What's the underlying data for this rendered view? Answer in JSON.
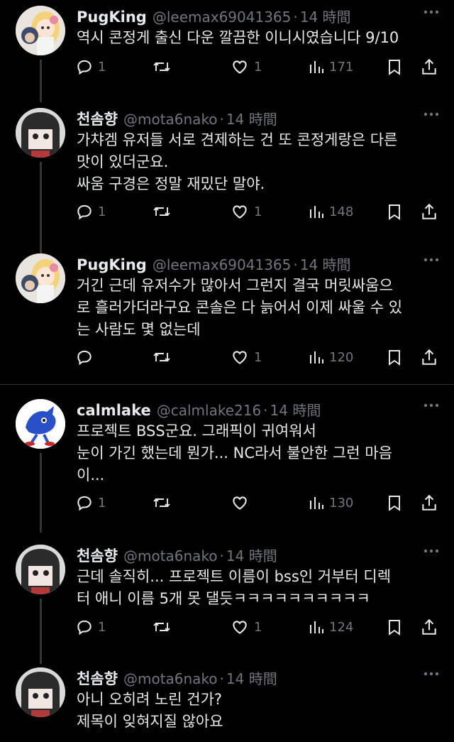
{
  "tweets": [
    {
      "name": "PugKing",
      "handle": "@leemax69041365",
      "dot": "·",
      "time": "14 時間",
      "text": "역시 콘정게 출신 다운 깔끔한 이니시였습니다 9/10",
      "replies": "1",
      "retweets": "",
      "likes": "1",
      "views": "171",
      "avatar": "pugking"
    },
    {
      "name": "천솜향",
      "handle": "@mota6nako",
      "dot": "·",
      "time": "14 時間",
      "text": "가챠겜 유저들 서로 견제하는 건 또 콘정게랑은 다른\n맛이 있더군요.\n싸움 구경은 정말 재밌단 말야.",
      "replies": "1",
      "retweets": "",
      "likes": "1",
      "views": "148",
      "avatar": "mota"
    },
    {
      "name": "PugKing",
      "handle": "@leemax69041365",
      "dot": "·",
      "time": "14 時間",
      "text": "거긴 근데 유저수가 많아서 그런지 결국 머릿싸움으\n로 흘러가더라구요 콘솔은 다 늙어서 이제 싸울 수 있\n는 사람도 몇 없는데",
      "replies": "",
      "retweets": "",
      "likes": "1",
      "views": "120",
      "avatar": "pugking"
    },
    {
      "name": "calmlake",
      "handle": "@calmlake216",
      "dot": "·",
      "time": "14 時間",
      "text": "프로젝트 BSS군요. 그래픽이 귀여워서\n눈이 가긴 했는데 뭔가... NC라서 불안한 그런 마음\n이...",
      "replies": "1",
      "retweets": "",
      "likes": "",
      "views": "130",
      "avatar": "calmlake"
    },
    {
      "name": "천솜향",
      "handle": "@mota6nako",
      "dot": "·",
      "time": "14 時間",
      "text": "근데 솔직히... 프로젝트 이름이 bss인 거부터 디렉\n터 애니 이름 5개 못 댈듯ㅋㅋㅋㅋㅋㅋㅋㅋㅋㅋ",
      "replies": "1",
      "retweets": "",
      "likes": "1",
      "views": "124",
      "avatar": "mota"
    },
    {
      "name": "천솜향",
      "handle": "@mota6nako",
      "dot": "·",
      "time": "14 時間",
      "text": "아니 오히려 노린 건가?\n제목이 잊혀지질 않아요",
      "replies": "",
      "retweets": "",
      "likes": "",
      "views": "",
      "avatar": "mota"
    }
  ],
  "colors": {
    "background": "#000000",
    "text": "#e7e9ea",
    "muted": "#71767b",
    "divider": "#2f3336"
  }
}
